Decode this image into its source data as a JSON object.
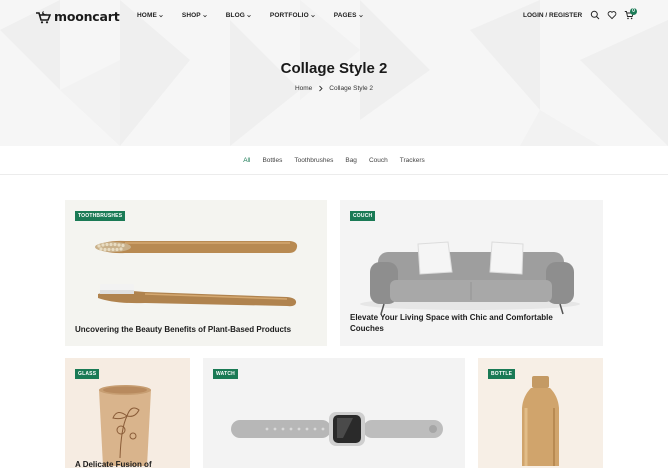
{
  "brand": {
    "name": "mooncart"
  },
  "nav": {
    "items": [
      "HOME",
      "SHOP",
      "BLOG",
      "PORTFOLIO",
      "PAGES"
    ],
    "login": "LOGIN / REGISTER",
    "cart_count": "0"
  },
  "hero": {
    "title": "Collage Style 2",
    "breadcrumb": {
      "home": "Home",
      "current": "Collage Style 2"
    }
  },
  "filters": {
    "items": [
      "All",
      "Bottles",
      "Toothbrushes",
      "Bag",
      "Couch",
      "Trackers"
    ],
    "active": "All"
  },
  "cards": [
    {
      "category": "TOOTHBRUSHES",
      "title": "Uncovering the Beauty Benefits of Plant-Based Products"
    },
    {
      "category": "COUCH",
      "title_line1": "Elevate Your Living Space with Chic and Comfortable",
      "title_line2": "Couches"
    },
    {
      "category": "GLASS",
      "title": "A Delicate Fusion of"
    },
    {
      "category": "WATCH"
    },
    {
      "category": "BOTTLE"
    }
  ],
  "colors": {
    "accent": "#1a7a55",
    "hero_bg": "#f6f6f6",
    "card_bg": "#f4f4f0"
  },
  "icons": [
    "mooncart-logo-icon",
    "search-icon",
    "heart-icon",
    "cart-icon",
    "chevron-down-icon",
    "chevron-right-icon"
  ]
}
